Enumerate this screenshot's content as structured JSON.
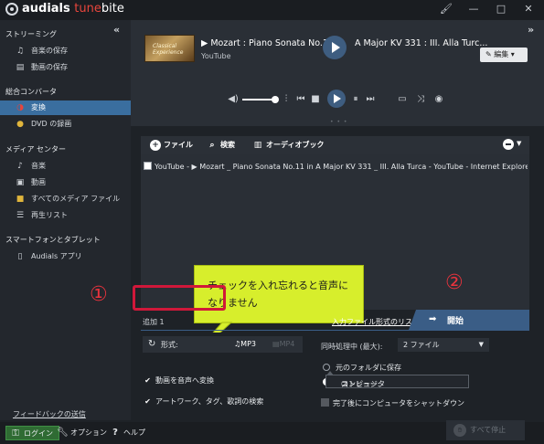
{
  "app": {
    "brand_name": "audials",
    "brand_product_1": "tune",
    "brand_product_2": "bite",
    "collapse_left": "«",
    "collapse_right": "»"
  },
  "window_controls": [
    "🖌",
    "—",
    "□",
    "✕"
  ],
  "sidebar": {
    "sections": [
      {
        "title": "ストリーミング",
        "items": [
          {
            "label": "音楽の保存",
            "icon": "music-note-icon"
          },
          {
            "label": "動画の保存",
            "icon": "film-icon"
          }
        ]
      },
      {
        "title": "総合コンバータ",
        "items": [
          {
            "label": "変換",
            "icon": "convert-icon",
            "active": true
          },
          {
            "label": "DVD の録画",
            "icon": "dvd-icon"
          }
        ]
      },
      {
        "title": "メディア センター",
        "items": [
          {
            "label": "音楽",
            "icon": "music-note-icon"
          },
          {
            "label": "動画",
            "icon": "video-icon"
          },
          {
            "label": "すべてのメディア ファイル",
            "icon": "folder-icon"
          },
          {
            "label": "再生リスト",
            "icon": "playlist-icon"
          }
        ]
      },
      {
        "title": "スマートフォンとタブレット",
        "items": [
          {
            "label": "Audials アプリ",
            "icon": "phone-icon"
          }
        ]
      }
    ],
    "feedback_link": "フィードバックの送信"
  },
  "bottom_bar": {
    "login": "ログイン",
    "options": "オプション",
    "help": "ヘルプ"
  },
  "player": {
    "thumbnail_text": "Classical Experience",
    "track_title": "▶ Mozart : Piano Sonata No.1",
    "track_title_tail": "A Major KV 331 : III. Alla Turc...",
    "track_source": "YouTube",
    "edit_label": "編集 ▾",
    "volume_level": 0.85
  },
  "toolbar": {
    "add_file": "ファイル",
    "search": "検索",
    "audiobook": "オーディオブック"
  },
  "file_list": {
    "rows": [
      "YouTube - ▶ Mozart _ Piano Sonata No.11 in A Major KV 331 _ III. Alla Turca - YouTube - Internet Explorer.mp4"
    ]
  },
  "annotations": {
    "callout_text": "チェックを入れ忘れると音声になりません",
    "marker_1": "①",
    "marker_2": "②"
  },
  "actions": {
    "add_count": "追加 1",
    "formats_link": "入力ファイル形式のリスト",
    "start": "開始",
    "stop_all": "すべて停止"
  },
  "settings": {
    "format_label": "形式:",
    "format_mp3": "MP3",
    "format_mp4": "MP4",
    "parallel_label": "同時処理中 (最大):",
    "parallel_value": "2 ファイル",
    "option_convert_audio": "動画を音声へ変換",
    "option_artwork": "アートワーク、タグ、歌詞の検索",
    "save_original_folder": "元のフォルダに保存",
    "storage_label": "ストレージ:",
    "storage_value": "コンピュータ",
    "shutdown": "完了後にコンピュータをシャットダウン"
  }
}
